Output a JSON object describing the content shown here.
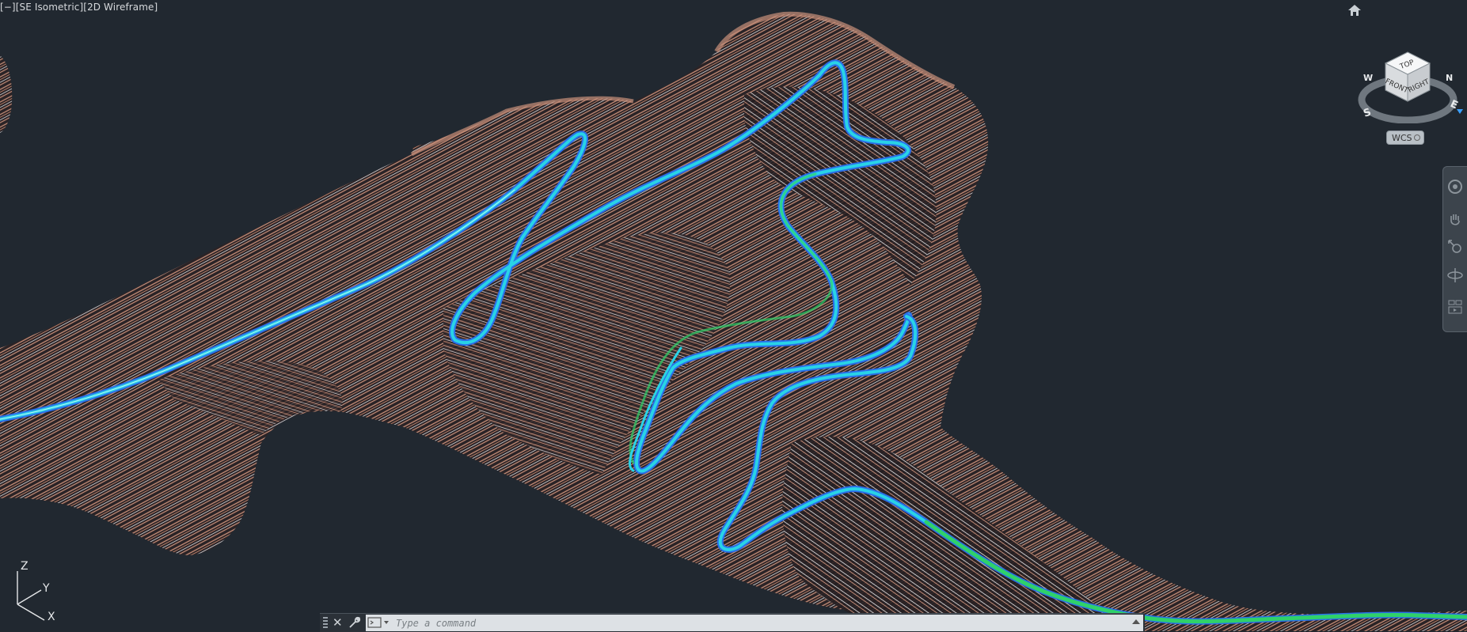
{
  "viewport": {
    "controls_label": "[−]",
    "view_label": "[SE Isometric]",
    "style_label": "[2D Wireframe]"
  },
  "viewcube": {
    "face_top": "TOP",
    "face_front": "FRONT",
    "face_right": "RIGHT",
    "compass_n": "N",
    "compass_s": "S",
    "compass_e": "E",
    "compass_w": "W"
  },
  "wcs": {
    "label": "WCS"
  },
  "navbar": {
    "tools": [
      "steering-wheel",
      "pan",
      "zoom",
      "orbit",
      "showmotion"
    ]
  },
  "ucs_icon": {
    "x": "X",
    "y": "Y",
    "z": "Z"
  },
  "command_line": {
    "placeholder": "Type a command",
    "close_symbol": "✕"
  },
  "colors": {
    "background": "#212830",
    "contour_brown": "#c9907a",
    "contour_white": "#e6e8ea",
    "road_cyan": "#29d3e6",
    "road_green": "#2fd16a",
    "road_blue": "#2a6ee8"
  }
}
